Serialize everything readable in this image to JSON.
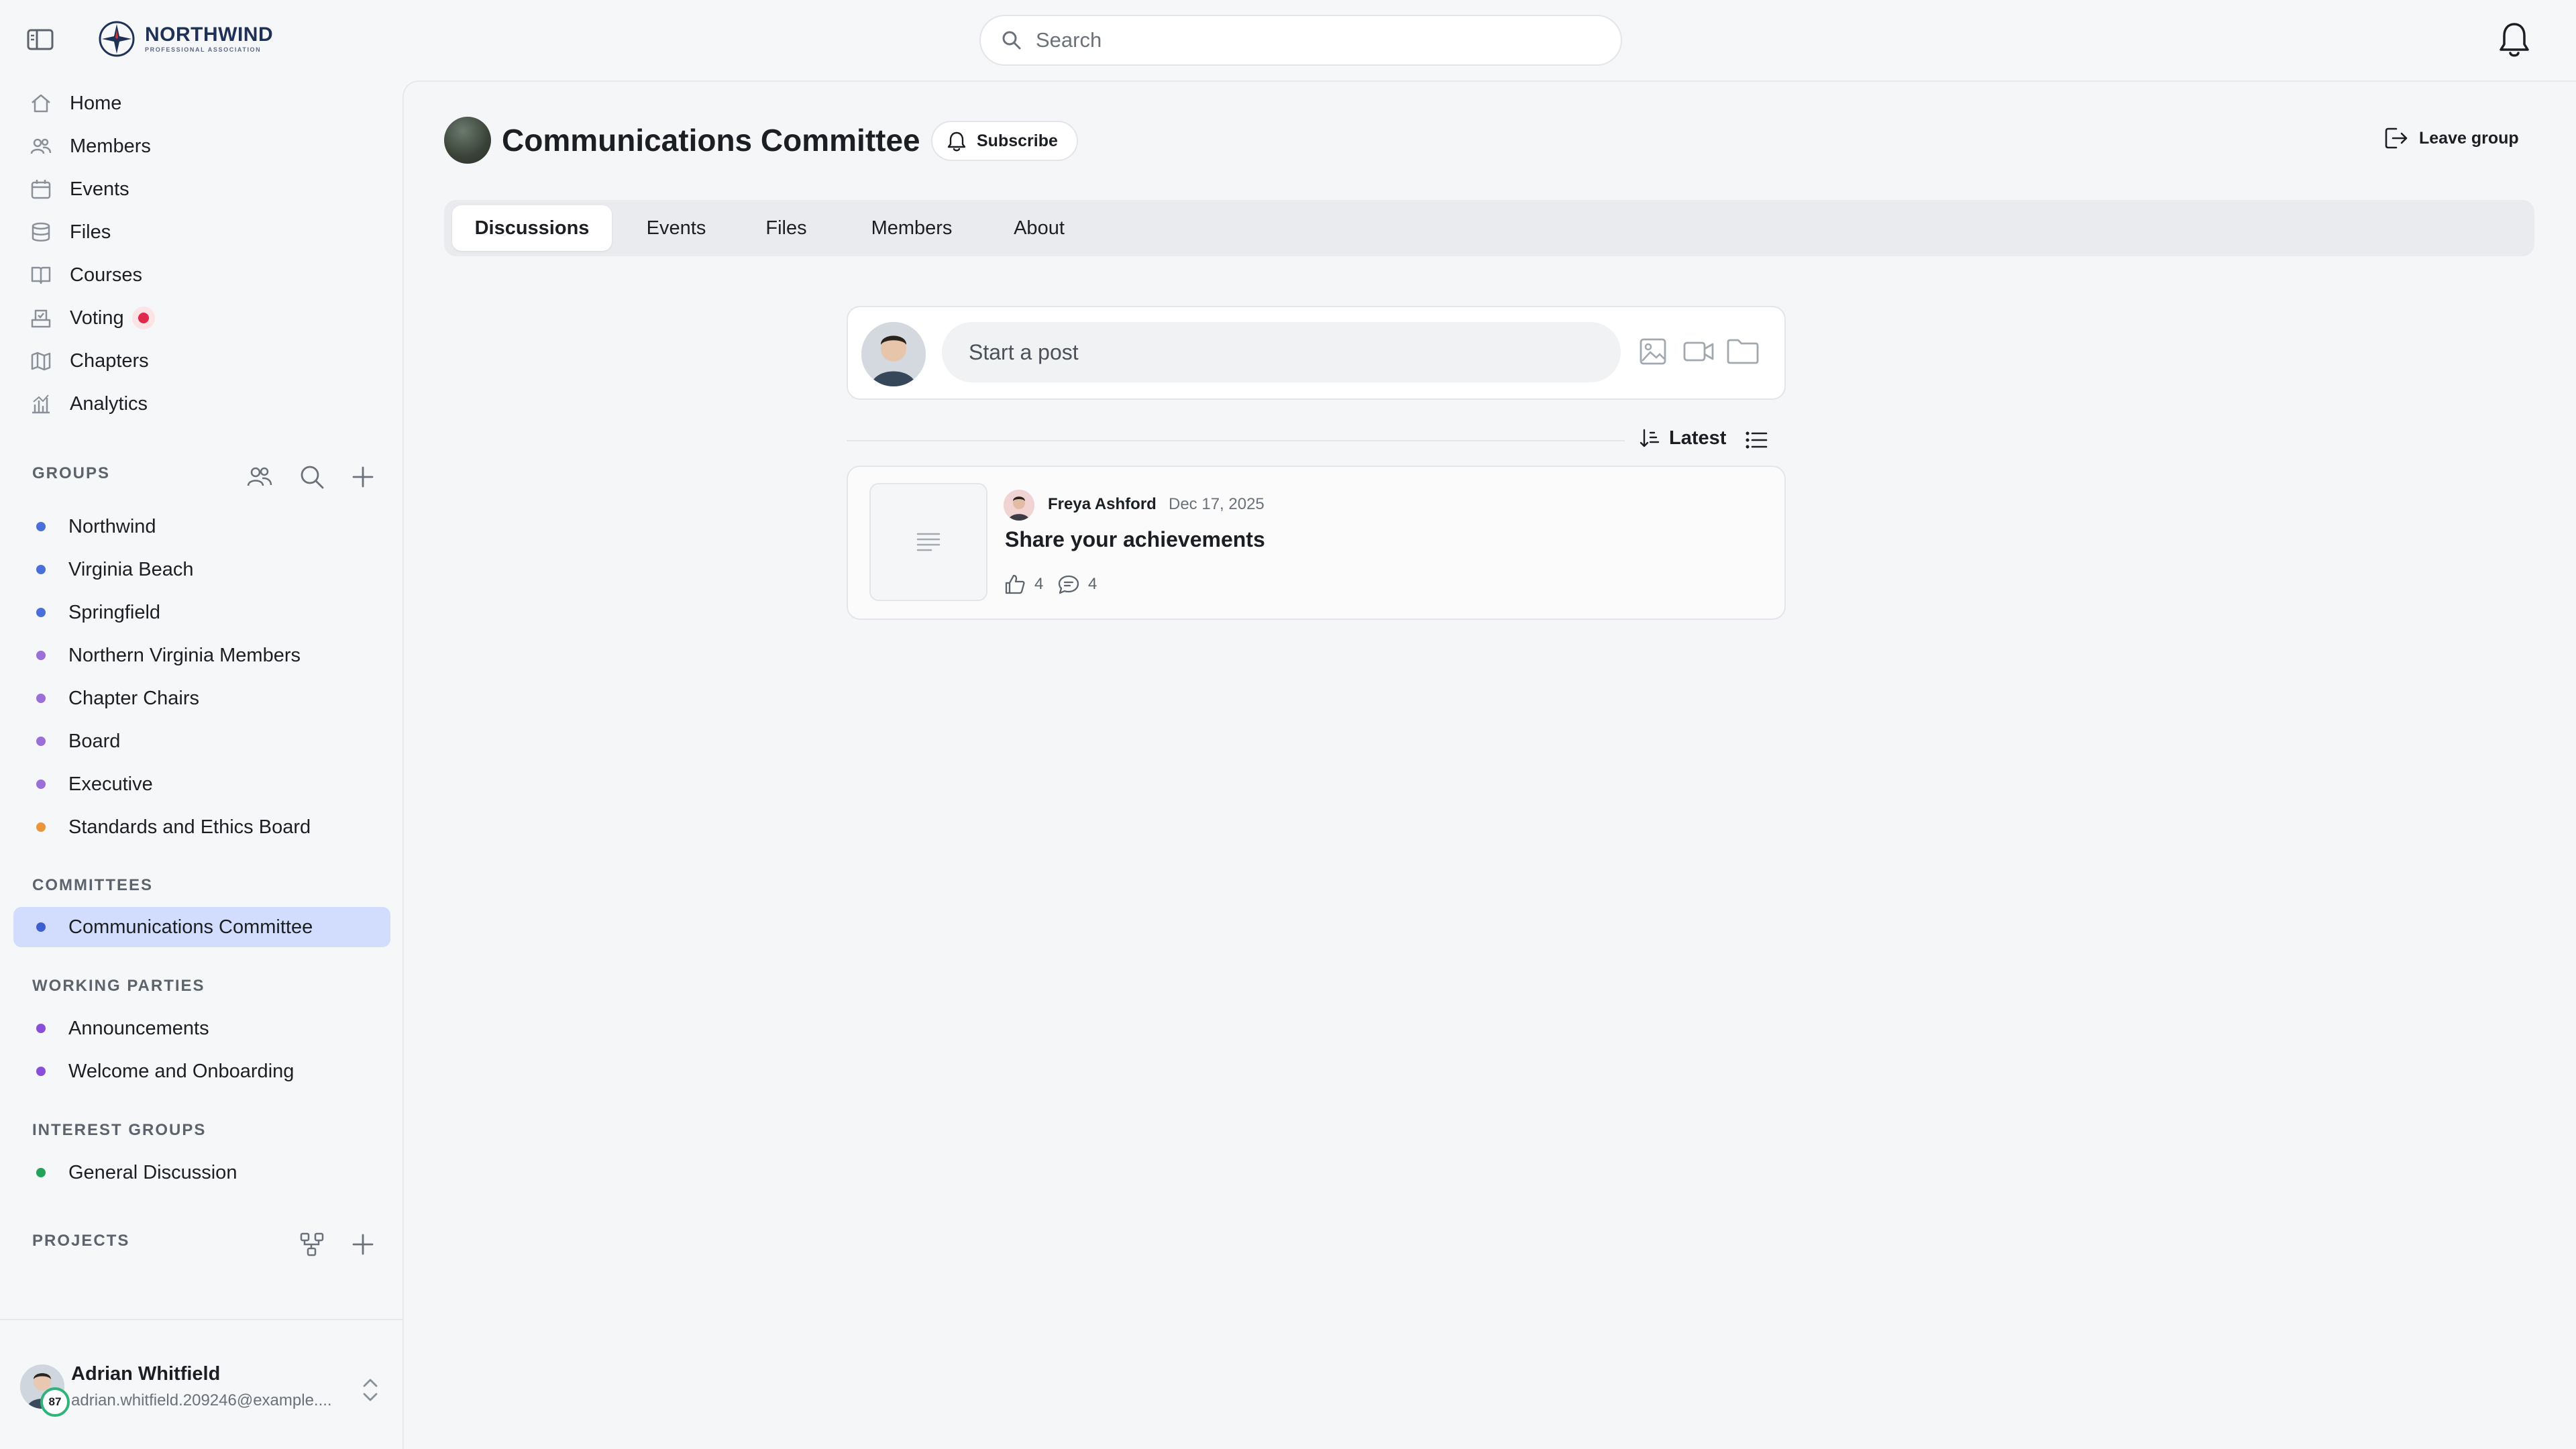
{
  "brand": {
    "name": "NORTHWIND",
    "tagline": "PROFESSIONAL ASSOCIATION"
  },
  "search": {
    "placeholder": "Search"
  },
  "nav": [
    {
      "label": "Home",
      "icon": "home-icon"
    },
    {
      "label": "Members",
      "icon": "users-icon"
    },
    {
      "label": "Events",
      "icon": "calendar-icon"
    },
    {
      "label": "Files",
      "icon": "database-icon"
    },
    {
      "label": "Courses",
      "icon": "book-icon"
    },
    {
      "label": "Voting",
      "icon": "ballot-icon",
      "alert": true
    },
    {
      "label": "Chapters",
      "icon": "map-icon"
    },
    {
      "label": "Analytics",
      "icon": "chart-icon"
    }
  ],
  "sections": {
    "groups": "GROUPS",
    "committees": "COMMITTEES",
    "working_parties": "WORKING PARTIES",
    "interest_groups": "INTEREST GROUPS",
    "projects": "PROJECTS"
  },
  "groups": [
    {
      "label": "Northwind",
      "color": "#4a6fd8"
    },
    {
      "label": "Virginia Beach",
      "color": "#4a6fd8"
    },
    {
      "label": "Springfield",
      "color": "#4a6fd8"
    },
    {
      "label": "Northern Virginia Members",
      "color": "#9b6fd8"
    },
    {
      "label": "Chapter Chairs",
      "color": "#9b6fd8"
    },
    {
      "label": "Board",
      "color": "#9b6fd8"
    },
    {
      "label": "Executive",
      "color": "#9b6fd8"
    },
    {
      "label": "Standards and Ethics Board",
      "color": "#e9963a"
    }
  ],
  "committees": [
    {
      "label": "Communications Committee",
      "color": "#3d5fd0",
      "active": true
    }
  ],
  "working_parties": [
    {
      "label": "Announcements",
      "color": "#8a4fd8"
    },
    {
      "label": "Welcome and Onboarding",
      "color": "#8a4fd8"
    }
  ],
  "interest_groups": [
    {
      "label": "General Discussion",
      "color": "#22a35a"
    }
  ],
  "user": {
    "name": "Adrian Whitfield",
    "email": "adrian.whitfield.209246@example....",
    "badge": "87"
  },
  "page": {
    "title": "Communications Committee",
    "subscribe": "Subscribe",
    "leave": "Leave group",
    "tabs": [
      "Discussions",
      "Events",
      "Files",
      "Members",
      "About"
    ],
    "composer_placeholder": "Start a post",
    "sort_label": "Latest"
  },
  "posts": [
    {
      "author": "Freya Ashford",
      "date": "Dec 17, 2025",
      "title": "Share your achievements",
      "likes": "4",
      "comments": "4"
    }
  ]
}
